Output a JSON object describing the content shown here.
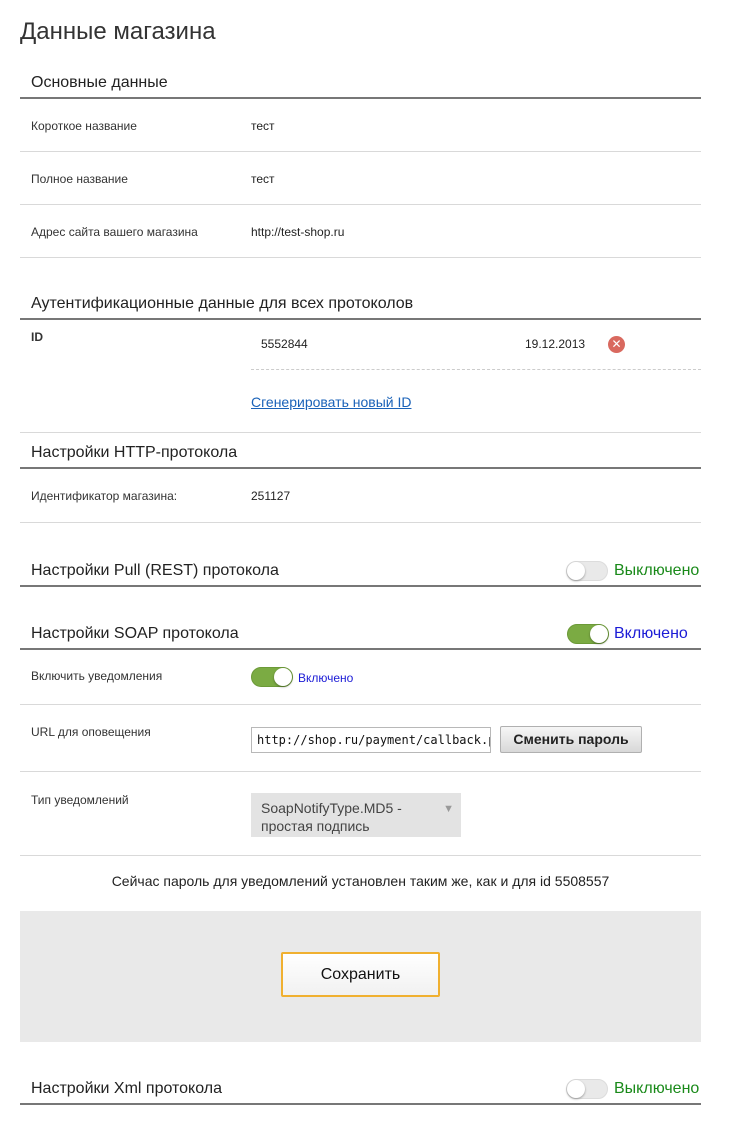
{
  "page_title": "Данные магазина",
  "basic": {
    "title": "Основные данные",
    "rows": [
      {
        "label": "Короткое название",
        "value": "тест"
      },
      {
        "label": "Полное название",
        "value": "тест"
      },
      {
        "label": "Адрес сайта вашего магазина",
        "value": "http://test-shop.ru"
      }
    ]
  },
  "auth": {
    "title": "Аутентификационные данные для всех протоколов",
    "id_label": "ID",
    "id_value": "5552844",
    "id_date": "19.12.2013",
    "delete_icon": "close-icon",
    "generate_link": "Сгенерировать новый ID"
  },
  "http": {
    "title": "Настройки HTTP-протокола",
    "shop_id_label": "Идентификатор магазина:",
    "shop_id_value": "251127"
  },
  "pull": {
    "title": "Настройки Pull (REST) протокола",
    "toggle_state": "off",
    "status": "Выключено"
  },
  "soap": {
    "title": "Настройки SOAP протокола",
    "toggle_state": "on",
    "status": "Включено",
    "notify_label": "Включить уведомления",
    "notify_status": "Включено",
    "url_label": "URL для оповещения",
    "url_value": "http://shop.ru/payment/callback.php",
    "change_password": "Сменить пароль",
    "type_label": "Тип уведомлений",
    "type_value": "SoapNotifyType.MD5 - простая подпись",
    "password_note": "Сейчас пароль для уведомлений установлен таким же, как и для id 5508557",
    "save": "Сохранить"
  },
  "xml": {
    "title": "Настройки Xml протокола",
    "toggle_state": "off",
    "status": "Выключено"
  },
  "colors": {
    "status_on": "#1b1bd6",
    "status_off": "#1a8a1a",
    "toggle_on": "#7bab43",
    "link": "#1a62b8",
    "delete": "#d9695f",
    "save_border": "#f0b030"
  }
}
